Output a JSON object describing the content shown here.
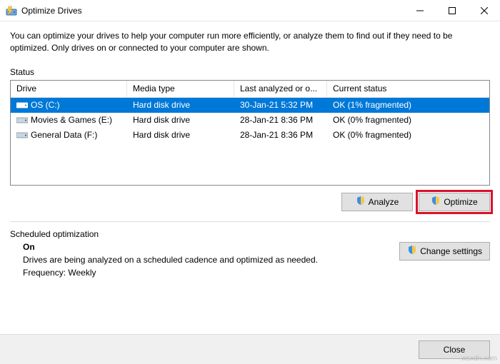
{
  "window": {
    "title": "Optimize Drives",
    "intro": "You can optimize your drives to help your computer run more efficiently, or analyze them to find out if they need to be optimized. Only drives on or connected to your computer are shown."
  },
  "status_label": "Status",
  "columns": {
    "drive": "Drive",
    "media": "Media type",
    "last": "Last analyzed or o...",
    "status": "Current status"
  },
  "drives": [
    {
      "name": "OS (C:)",
      "media": "Hard disk drive",
      "last": "30-Jan-21 5:32 PM",
      "status": "OK (1% fragmented)",
      "selected": true
    },
    {
      "name": "Movies & Games (E:)",
      "media": "Hard disk drive",
      "last": "28-Jan-21 8:36 PM",
      "status": "OK (0% fragmented)",
      "selected": false
    },
    {
      "name": "General Data (F:)",
      "media": "Hard disk drive",
      "last": "28-Jan-21 8:36 PM",
      "status": "OK (0% fragmented)",
      "selected": false
    }
  ],
  "buttons": {
    "analyze": "Analyze",
    "optimize": "Optimize",
    "change_settings": "Change settings",
    "close": "Close"
  },
  "scheduled": {
    "heading": "Scheduled optimization",
    "state": "On",
    "desc": "Drives are being analyzed on a scheduled cadence and optimized as needed.",
    "freq": "Frequency: Weekly"
  },
  "watermark": "wsxdn.com"
}
